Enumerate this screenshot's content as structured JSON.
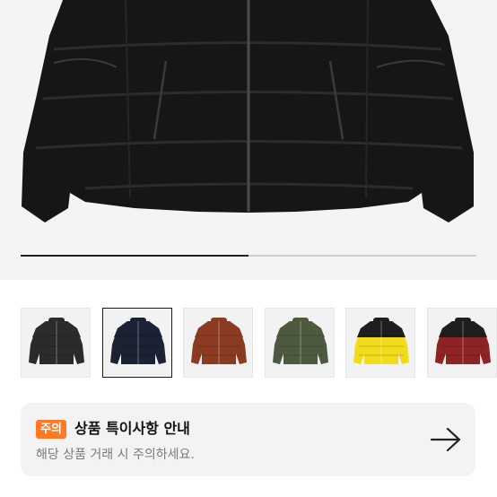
{
  "gallery": {
    "progress": 0.5,
    "thumbnails": [
      {
        "color_name": "black",
        "body_color": "#2b2b2b",
        "shoulder_color": "#2b2b2b",
        "selected": false
      },
      {
        "color_name": "navy",
        "body_color": "#1c2233",
        "shoulder_color": "#1c2233",
        "selected": true
      },
      {
        "color_name": "brown",
        "body_color": "#8a3b22",
        "shoulder_color": "#8a3b22",
        "selected": false
      },
      {
        "color_name": "olive",
        "body_color": "#4d5a40",
        "shoulder_color": "#4d5a40",
        "selected": false
      },
      {
        "color_name": "yellow",
        "body_color": "#f0dc1c",
        "shoulder_color": "#1e1e1e",
        "selected": false
      },
      {
        "color_name": "red",
        "body_color": "#8e2326",
        "shoulder_color": "#1e1e1e",
        "selected": false
      }
    ]
  },
  "notice": {
    "badge": "주의",
    "title": "상품 특이사항 안내",
    "description": "해당 상품 거래 시 주의하세요.",
    "arrow_icon": "arrow-right-icon"
  },
  "colors": {
    "badge_bg": "#ff7a22",
    "card_bg": "#f3f3f5"
  }
}
